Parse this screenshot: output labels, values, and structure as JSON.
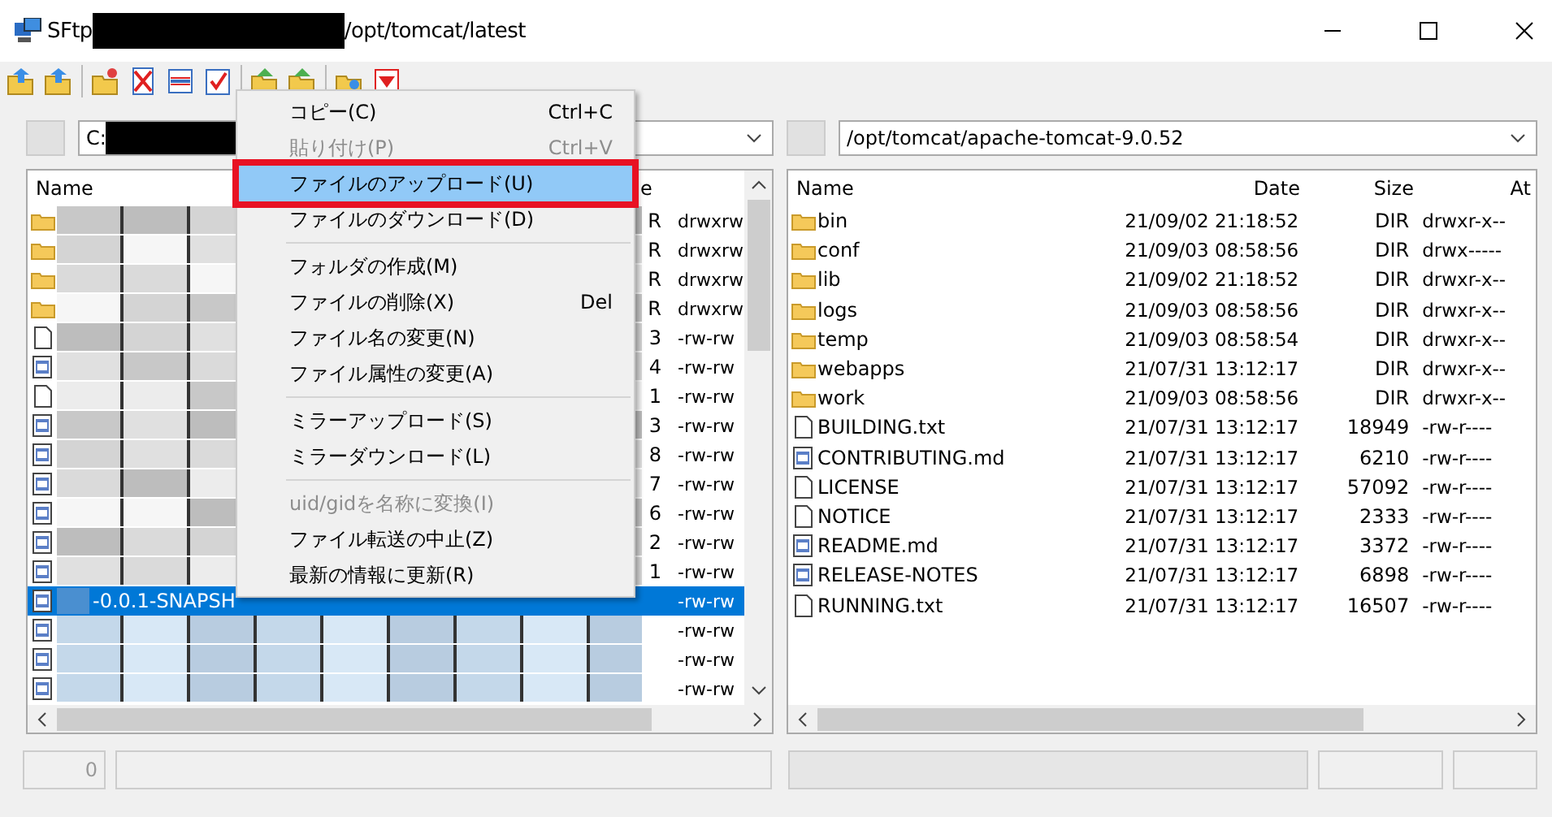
{
  "window": {
    "title_prefix": "SFtp",
    "title_path": "/opt/tomcat/latest"
  },
  "left_pane": {
    "path": "C:",
    "columns": [
      "Name",
      "e"
    ],
    "rows": [
      {
        "kind": "folder",
        "size": "R",
        "attributes": "drwxrw",
        "selected": false
      },
      {
        "kind": "folder",
        "size": "R",
        "attributes": "drwxrw",
        "selected": false
      },
      {
        "kind": "folder",
        "size": "R",
        "attributes": "drwxrw",
        "selected": false
      },
      {
        "kind": "folder",
        "size": "R",
        "attributes": "drwxrw",
        "selected": false
      },
      {
        "kind": "file",
        "size": "3",
        "attributes": "-rw-rw",
        "selected": false
      },
      {
        "kind": "doc",
        "size": "4",
        "attributes": "-rw-rw",
        "selected": false
      },
      {
        "kind": "file",
        "size": "1",
        "attributes": "-rw-rw",
        "selected": false
      },
      {
        "kind": "doc",
        "size": "3",
        "attributes": "-rw-rw",
        "selected": false
      },
      {
        "kind": "doc",
        "size": "8",
        "attributes": "-rw-rw",
        "selected": false
      },
      {
        "kind": "doc",
        "size": "7",
        "attributes": "-rw-rw",
        "selected": false
      },
      {
        "kind": "doc",
        "size": "6",
        "attributes": "-rw-rw",
        "selected": false
      },
      {
        "kind": "doc",
        "size": "2",
        "attributes": "-rw-rw",
        "selected": false
      },
      {
        "kind": "doc",
        "size": "1",
        "attributes": "-rw-rw",
        "selected": false
      },
      {
        "kind": "doc",
        "name": "-0.0.1-SNAPSH",
        "attributes": "-rw-rw",
        "selected": true
      },
      {
        "kind": "doc",
        "attributes": "-rw-rw",
        "selected": false
      },
      {
        "kind": "doc",
        "attributes": "-rw-rw",
        "selected": false
      },
      {
        "kind": "doc",
        "attributes": "-rw-rw",
        "selected": false
      }
    ]
  },
  "right_pane": {
    "path": "/opt/tomcat/apache-tomcat-9.0.52",
    "columns": [
      "Name",
      "Date",
      "Size",
      "At"
    ],
    "rows": [
      {
        "kind": "folder",
        "name": "bin",
        "date": "21/09/02 21:18:52",
        "size": "DIR",
        "attributes": "drwxr-x--"
      },
      {
        "kind": "folder",
        "name": "conf",
        "date": "21/09/03 08:58:56",
        "size": "DIR",
        "attributes": "drwx-----"
      },
      {
        "kind": "folder",
        "name": "lib",
        "date": "21/09/02 21:18:52",
        "size": "DIR",
        "attributes": "drwxr-x--"
      },
      {
        "kind": "folder",
        "name": "logs",
        "date": "21/09/03 08:58:56",
        "size": "DIR",
        "attributes": "drwxr-x--"
      },
      {
        "kind": "folder",
        "name": "temp",
        "date": "21/09/03 08:58:54",
        "size": "DIR",
        "attributes": "drwxr-x--"
      },
      {
        "kind": "folder",
        "name": "webapps",
        "date": "21/07/31 13:12:17",
        "size": "DIR",
        "attributes": "drwxr-x--"
      },
      {
        "kind": "folder",
        "name": "work",
        "date": "21/09/03 08:58:56",
        "size": "DIR",
        "attributes": "drwxr-x--"
      },
      {
        "kind": "file",
        "name": "BUILDING.txt",
        "date": "21/07/31 13:12:17",
        "size": "18949",
        "attributes": "-rw-r----"
      },
      {
        "kind": "doc",
        "name": "CONTRIBUTING.md",
        "date": "21/07/31 13:12:17",
        "size": "6210",
        "attributes": "-rw-r----"
      },
      {
        "kind": "file",
        "name": "LICENSE",
        "date": "21/07/31 13:12:17",
        "size": "57092",
        "attributes": "-rw-r----"
      },
      {
        "kind": "file",
        "name": "NOTICE",
        "date": "21/07/31 13:12:17",
        "size": "2333",
        "attributes": "-rw-r----"
      },
      {
        "kind": "doc",
        "name": "README.md",
        "date": "21/07/31 13:12:17",
        "size": "3372",
        "attributes": "-rw-r----"
      },
      {
        "kind": "doc",
        "name": "RELEASE-NOTES",
        "date": "21/07/31 13:12:17",
        "size": "6898",
        "attributes": "-rw-r----"
      },
      {
        "kind": "file",
        "name": "RUNNING.txt",
        "date": "21/07/31 13:12:17",
        "size": "16507",
        "attributes": "-rw-r----"
      }
    ]
  },
  "context_menu": {
    "groups": [
      [
        {
          "label": "コピー(C)",
          "shortcut": "Ctrl+C",
          "disabled": false,
          "selected": false,
          "outlined": false
        },
        {
          "label": "貼り付け(P)",
          "shortcut": "Ctrl+V",
          "disabled": true,
          "selected": false,
          "outlined": false
        },
        {
          "label": "ファイルのアップロード(U)",
          "disabled": false,
          "selected": true,
          "outlined": true
        },
        {
          "label": "ファイルのダウンロード(D)",
          "disabled": false,
          "selected": false,
          "outlined": false
        }
      ],
      [
        {
          "label": "フォルダの作成(M)",
          "disabled": false,
          "selected": false,
          "outlined": false
        },
        {
          "label": "ファイルの削除(X)",
          "shortcut": "Del",
          "disabled": false,
          "selected": false,
          "outlined": false
        },
        {
          "label": "ファイル名の変更(N)",
          "disabled": false,
          "selected": false,
          "outlined": false
        },
        {
          "label": "ファイル属性の変更(A)",
          "disabled": false,
          "selected": false,
          "outlined": false
        }
      ],
      [
        {
          "label": "ミラーアップロード(S)",
          "disabled": false,
          "selected": false,
          "outlined": false
        },
        {
          "label": "ミラーダウンロード(L)",
          "disabled": false,
          "selected": false,
          "outlined": false
        }
      ],
      [
        {
          "label": "uid/gidを名称に変換(I)",
          "disabled": true,
          "selected": false,
          "outlined": false
        },
        {
          "label": "ファイル転送の中止(Z)",
          "disabled": false,
          "selected": false,
          "outlined": false
        },
        {
          "label": "最新の情報に更新(R)",
          "disabled": false,
          "selected": false,
          "outlined": false
        }
      ]
    ]
  },
  "status_bar": {
    "count": "0"
  }
}
